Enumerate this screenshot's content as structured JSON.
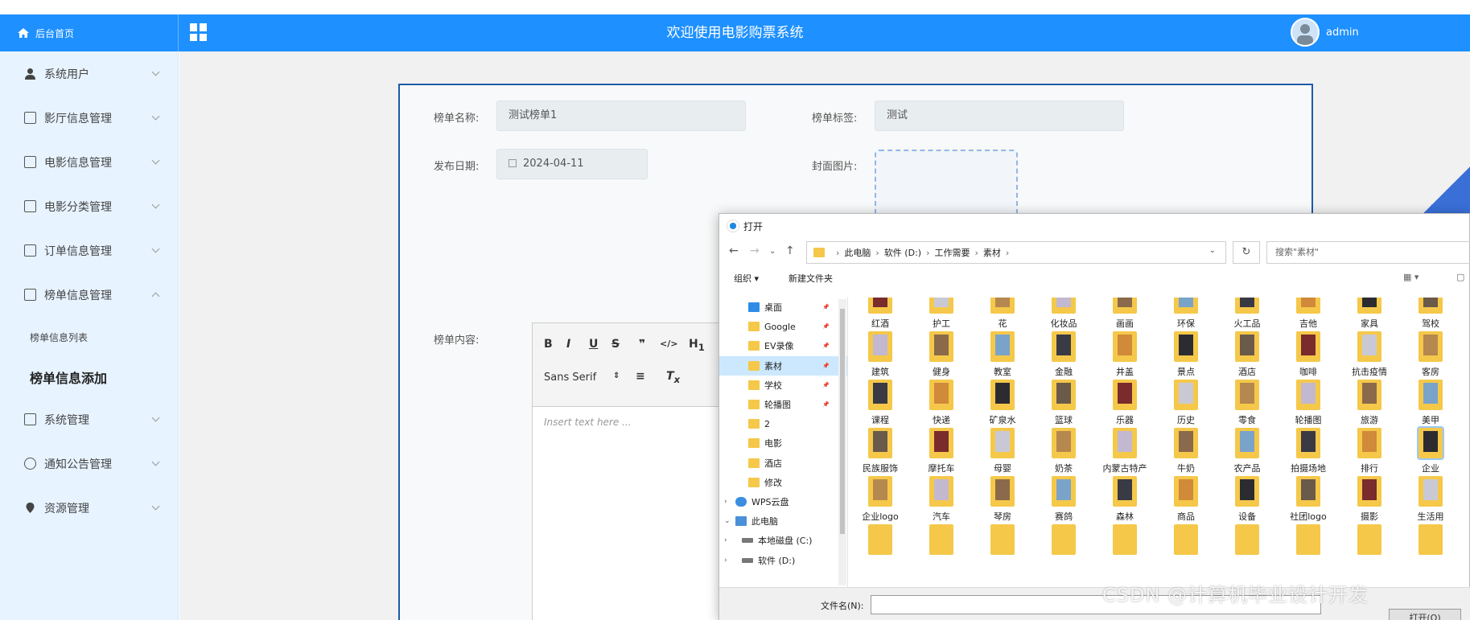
{
  "header": {
    "home_label": "后台首页",
    "title": "欢迎使用电影购票系统",
    "username": "admin"
  },
  "sidebar": {
    "items": [
      {
        "label": "系统用户",
        "icon": "user-icon"
      },
      {
        "label": "影厅信息管理",
        "icon": "document-icon"
      },
      {
        "label": "电影信息管理",
        "icon": "document-icon"
      },
      {
        "label": "电影分类管理",
        "icon": "document-icon"
      },
      {
        "label": "订单信息管理",
        "icon": "document-icon"
      },
      {
        "label": "榜单信息管理",
        "icon": "document-icon",
        "expanded": true
      },
      {
        "label": "系统管理",
        "icon": "image-icon"
      },
      {
        "label": "通知公告管理",
        "icon": "info-icon"
      },
      {
        "label": "资源管理",
        "icon": "location-icon"
      }
    ],
    "subitems": [
      "榜单信息列表",
      "榜单信息添加"
    ],
    "active_subitem": "榜单信息添加"
  },
  "form": {
    "name_label": "榜单名称:",
    "name_value": "测试榜单1",
    "tag_label": "榜单标签:",
    "tag_value": "测试",
    "date_label": "发布日期:",
    "date_value": "2024-04-11",
    "cover_label": "封面图片:",
    "content_label": "榜单内容:",
    "editor": {
      "font": "Sans Serif",
      "placeholder": "Insert text here ..."
    }
  },
  "dialog": {
    "title": "打开",
    "path": [
      "此电脑",
      "软件 (D:)",
      "工作需要",
      "素材"
    ],
    "search_placeholder": "搜索\"素材\"",
    "organize": "组织 ▾",
    "new_folder": "新建文件夹",
    "tree": [
      {
        "label": "桌面",
        "kind": "desktop",
        "pin": true
      },
      {
        "label": "Google",
        "kind": "folder",
        "pin": true
      },
      {
        "label": "EV录像",
        "kind": "folder",
        "pin": true
      },
      {
        "label": "素材",
        "kind": "folder",
        "pin": true,
        "selected": true
      },
      {
        "label": "学校",
        "kind": "folder",
        "pin": true
      },
      {
        "label": "轮播图",
        "kind": "folder",
        "pin": true
      },
      {
        "label": "2",
        "kind": "folder"
      },
      {
        "label": "电影",
        "kind": "folder"
      },
      {
        "label": "酒店",
        "kind": "folder"
      },
      {
        "label": "修改",
        "kind": "folder"
      },
      {
        "label": "WPS云盘",
        "kind": "cloud",
        "arrow": "›"
      },
      {
        "label": "此电脑",
        "kind": "pc",
        "arrow": "⌄"
      },
      {
        "label": "本地磁盘 (C:)",
        "kind": "drive",
        "arrow": "›"
      },
      {
        "label": "软件 (D:)",
        "kind": "drive",
        "arrow": "›"
      }
    ],
    "folders": [
      [
        "红酒",
        "护工",
        "花",
        "化妆品",
        "画画",
        "环保",
        "火工品",
        "吉他",
        "家具",
        "驾校"
      ],
      [
        "建筑",
        "健身",
        "教室",
        "金融",
        "井盖",
        "景点",
        "酒店",
        "咖啡",
        "抗击疫情",
        "客房"
      ],
      [
        "课程",
        "快递",
        "矿泉水",
        "篮球",
        "乐器",
        "历史",
        "零食",
        "轮播图",
        "旅游",
        "美甲"
      ],
      [
        "民族服饰",
        "摩托车",
        "母婴",
        "奶茶",
        "内蒙古特产",
        "牛奶",
        "农产品",
        "拍摄场地",
        "排行",
        "企业"
      ],
      [
        "企业logo",
        "汽车",
        "琴房",
        "赛鸽",
        "森林",
        "商品",
        "设备",
        "社团logo",
        "摄影",
        "生活用"
      ]
    ],
    "filename_label": "文件名(N):",
    "open_button": "打开(O)"
  },
  "watermark": "CSDN @计算机毕业设计开发",
  "colors": {
    "topbar": "#1e90ff",
    "sidebar": "#e7f3ff",
    "panel_border": "#1e5aa8"
  }
}
